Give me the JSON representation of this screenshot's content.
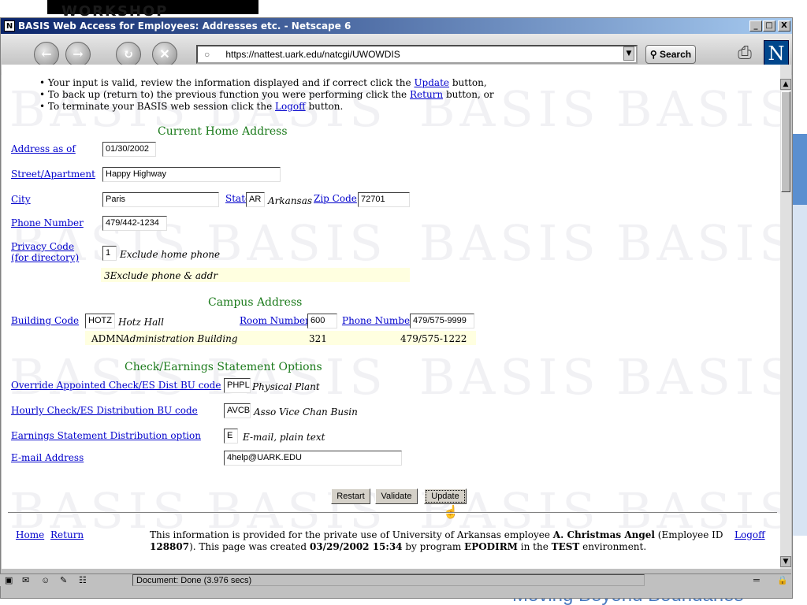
{
  "slide": {
    "header_text": "WORKSHOP",
    "slogan": "Moving Beyond Boundaries"
  },
  "window": {
    "title": "BASIS Web Access for Employees: Addresses etc. - Netscape 6",
    "minimize": "_",
    "maximize": "□",
    "close": "X"
  },
  "toolbar": {
    "back_icon": "back-arrow-icon",
    "forward_icon": "forward-arrow-icon",
    "reload_icon": "reload-icon",
    "stop_icon": "stop-icon",
    "url": "https://nattest.uark.edu/natcgi/UWOWDIS",
    "search_label": "Search",
    "logo": "N"
  },
  "instructions": {
    "line1_pre": "Your input is valid, review the information displayed and if correct click the",
    "line1_link": "Update",
    "line1_post": "button,",
    "line2_pre": "To back up (return to) the previous function you were performing click the",
    "line2_link": "Return",
    "line2_post": "button, or",
    "line3_pre": "To terminate your BASIS web session click the",
    "line3_link": "Logoff",
    "line3_post": "button."
  },
  "watermark": "BASIS",
  "home_address": {
    "heading": "Current Home Address",
    "address_as_of_label": "Address as of",
    "address_as_of": "01/30/2002",
    "street_label": "Street/Apartment",
    "street": "Happy Highway",
    "city_label": "City",
    "city": "Paris",
    "state_label": "State",
    "state": "AR",
    "state_name": "Arkansas",
    "zip_label": "Zip Code",
    "zip": "72701",
    "phone_label": "Phone Number",
    "phone": "479/442-1234",
    "privacy_label_1": "Privacy Code",
    "privacy_label_2": "(for directory)",
    "privacy_code": "1",
    "privacy_desc": "Exclude home phone",
    "privacy_alt": "3Exclude phone & addr"
  },
  "campus_address": {
    "heading": "Campus Address",
    "building_label": "Building Code",
    "building_code": "HOTZ",
    "building_name": "Hotz Hall",
    "room_label": "Room Number",
    "room": "600",
    "phone_label": "Phone Number",
    "phone": "479/575-9999",
    "alt_building_code": "ADMN",
    "alt_building_name": "Administration Building",
    "alt_room": "321",
    "alt_phone": "479/575-1222"
  },
  "check_options": {
    "heading": "Check/Earnings Statement Options",
    "override_label": "Override Appointed Check/ES Dist BU code",
    "override_code": "PHPL",
    "override_desc": "Physical Plant",
    "hourly_label": "Hourly Check/ES Distribution BU code",
    "hourly_code": "AVCB",
    "hourly_desc": "Asso Vice Chan Busin",
    "earnings_label": "Earnings Statement Distribution option",
    "earnings_code": "E",
    "earnings_desc": "E-mail, plain text",
    "email_label": "E-mail Address",
    "email": "4help@UARK.EDU"
  },
  "actions": {
    "restart": "Restart",
    "validate": "Validate",
    "update": "Update"
  },
  "footer": {
    "home": "Home",
    "return": "Return",
    "logoff": "Logoff",
    "text_1": "This information is provided for the private use of University of Arkansas employee",
    "employee_name": "A. Christmas Angel",
    "text_2": "(Employee ID",
    "employee_id": "128807",
    "text_3": "). This page was created",
    "created": "03/29/2002 15:34",
    "text_4": "by program",
    "program": "EPODIRM",
    "text_5": "in the",
    "environment": "TEST",
    "text_6": "environment."
  },
  "status": {
    "text": "Document: Done (3.976 secs)"
  }
}
